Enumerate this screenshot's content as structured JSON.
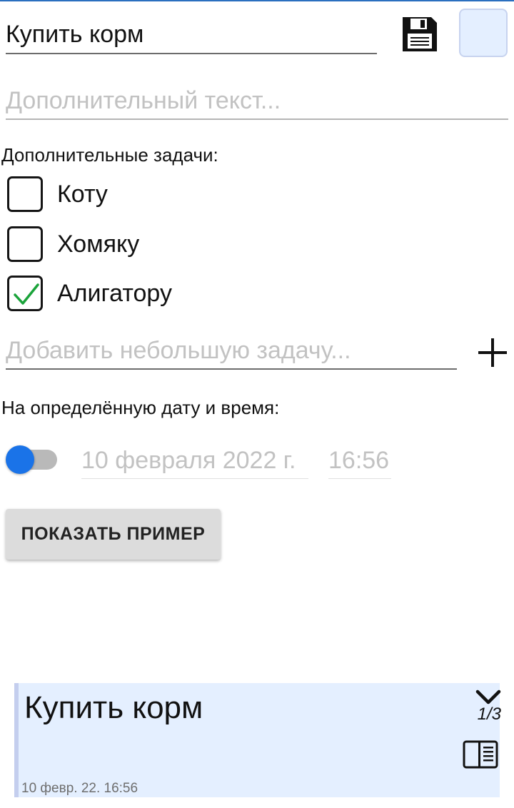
{
  "form": {
    "title_value": "Купить корм",
    "description_placeholder": "Дополнительный текст...",
    "save_icon": "floppy-disk-icon",
    "color_swatch": "#e4efff"
  },
  "subtasks": {
    "label": "Дополнительные задачи:",
    "items": [
      {
        "label": "Коту",
        "checked": false
      },
      {
        "label": "Хомяку",
        "checked": false
      },
      {
        "label": "Алигатору",
        "checked": true
      }
    ],
    "add_placeholder": "Добавить небольшую задачу...",
    "add_icon": "plus-icon"
  },
  "schedule": {
    "label": "На определённую дату и время:",
    "toggle_color": "#1a73e8",
    "date": "10 февраля 2022 г.",
    "time": "16:56"
  },
  "actions": {
    "show_example": "ПОКАЗАТЬ ПРИМЕР"
  },
  "preview": {
    "title": "Купить корм",
    "counter": "1/3",
    "date": "10 февр. 22. 16:56",
    "expand_icon": "chevron-down-icon",
    "details_icon": "book-icon",
    "background": "#e4efff"
  },
  "colors": {
    "check_green": "#1aa33a",
    "accent_blue": "#1a73e8"
  }
}
